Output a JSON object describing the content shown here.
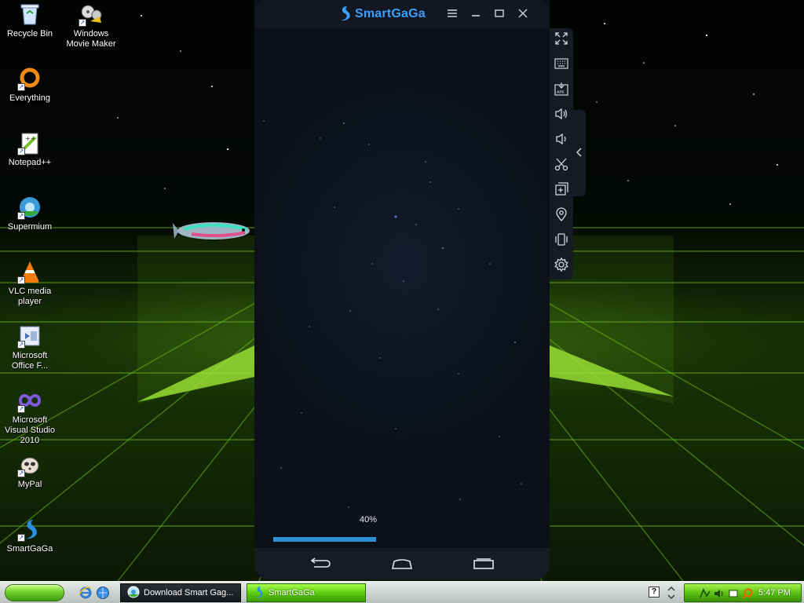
{
  "desktop": {
    "icons": [
      {
        "label": "Recycle Bin"
      },
      {
        "label": "Windows Movie Maker"
      },
      {
        "label": "Everything"
      },
      {
        "label": "Notepad++"
      },
      {
        "label": "Supermium"
      },
      {
        "label": "VLC media player"
      },
      {
        "label": "Microsoft Office F..."
      },
      {
        "label": "Microsoft Visual Studio 2010"
      },
      {
        "label": "MyPal"
      },
      {
        "label": "SmartGaGa"
      }
    ]
  },
  "emulator": {
    "brand": "SmartGaGa",
    "progress_text": "40%",
    "progress_value": 0.4,
    "accent_color": "#2f8fd6",
    "title_controls": [
      "menu-icon",
      "minimize-icon",
      "maximize-icon",
      "close-icon"
    ],
    "side_tools": [
      "fullscreen-icon",
      "keyboard-icon",
      "apk-install-icon",
      "volume-up-icon",
      "volume-down-icon",
      "screenshot-scissors-icon",
      "multi-instance-icon",
      "location-icon",
      "shake-icon",
      "settings-icon"
    ],
    "nav_buttons": [
      "back-icon",
      "home-icon",
      "recents-icon"
    ]
  },
  "taskbar": {
    "tasks": [
      {
        "label": "Download Smart Gag...",
        "active": false
      },
      {
        "label": "SmartGaGa",
        "active": true
      }
    ],
    "clock": "5:47 PM"
  }
}
